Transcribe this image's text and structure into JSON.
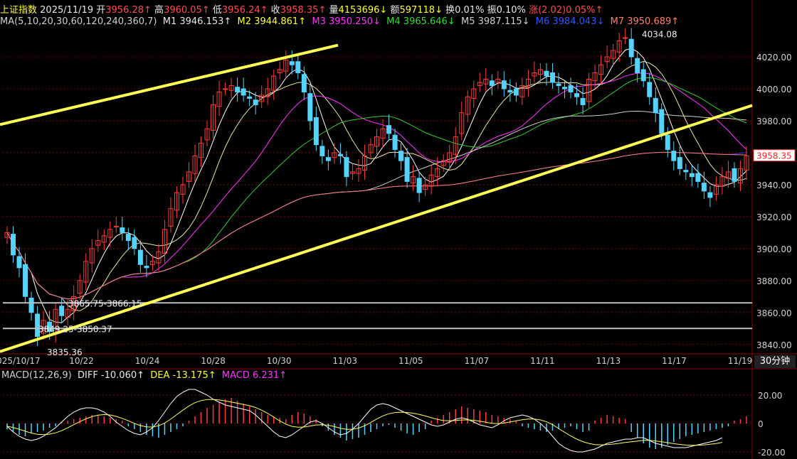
{
  "header": {
    "name": "上证指数",
    "date": "2025/11/19",
    "open_label": "开",
    "open": "3956.28↑",
    "high_label": "高",
    "high": "3960.05↑",
    "low_label": "低",
    "low": "3956.24↑",
    "close_label": "收",
    "close": "3958.35↑",
    "vol_label": "量",
    "vol": "4153696↓",
    "amt_label": "额",
    "amt": "597118↓",
    "turn_label": "换",
    "turn": "0.01%",
    "amp_label": "振",
    "amp": "0.10%",
    "chg_label": "涨",
    "chg": "(2.02)",
    "chg_pct": "0.05%↑"
  },
  "ma": {
    "label": "MA(5,10,20,30,60,120,240,360,7)",
    "m1": "M1 3946.153↑",
    "m2": "M2 3944.861↑",
    "m3": "M3 3950.250↓",
    "m4": "M4 3965.646↓",
    "m5": "M5 3987.115↓",
    "m6": "M6 3984.043↓",
    "m7": "M7 3950.689↑"
  },
  "macd_header": {
    "label": "MACD(12,26,9)",
    "diff": "DIFF -10.060↑",
    "dea": "DEA -13.175↑",
    "macd": "MACD 6.231↑"
  },
  "period": "30分钟",
  "colors": {
    "up": "#ff3b3b",
    "down": "#54d3ff",
    "trendline": "#ffff55",
    "hline": "#c0c0c0",
    "grid": "#7a0000",
    "ma1": "#ffffff",
    "ma2": "#e8e8a0",
    "ma3": "#ff33ff",
    "ma4": "#33cc33",
    "ma5": "#cfcfcf",
    "ma6": "#2a3cff",
    "ma7": "#ff7f6a"
  },
  "chart_data": {
    "type": "candlestick",
    "price_ticks": [
      "4020.00",
      "4000.00",
      "3980.00",
      "3960.00",
      "3940.00",
      "3920.00",
      "3900.00",
      "3880.00",
      "3860.00",
      "3840.00"
    ],
    "price_range": [
      3835,
      4036
    ],
    "x_labels": [
      "2025/10/17",
      "10/22",
      "10/24",
      "10/28",
      "10/30",
      "11/03",
      "11/05",
      "11/07",
      "11/11",
      "11/13",
      "11/17",
      "11/19"
    ],
    "annotations": [
      {
        "text": "4034.08",
        "price": 4034.08
      },
      {
        "text": "3865.75-3866.15",
        "price": 3866
      },
      {
        "text": "3849.25-3850.37",
        "price": 3850
      },
      {
        "text": "3835.36",
        "price": 3835.36
      }
    ],
    "last_price": "3958.35",
    "hlines": [
      3866,
      3850
    ],
    "trendlines": [
      {
        "from_price": 3977.6,
        "to_price": 4027.3,
        "label": "upper"
      },
      {
        "from_price": 3835.5,
        "to_price": 3989.6,
        "label": "lower"
      }
    ],
    "closes": [
      3910,
      3896,
      3888,
      3870,
      3860,
      3845,
      3855,
      3848,
      3862,
      3858,
      3862,
      3870,
      3880,
      3892,
      3900,
      3905,
      3908,
      3912,
      3914,
      3910,
      3905,
      3900,
      3890,
      3888,
      3892,
      3898,
      3912,
      3925,
      3935,
      3940,
      3948,
      3958,
      3966,
      3975,
      3990,
      3998,
      4000,
      4002,
      3998,
      3996,
      3994,
      3990,
      3996,
      4000,
      4008,
      4012,
      4018,
      4015,
      4010,
      3998,
      3980,
      3965,
      3958,
      3955,
      3960,
      3958,
      3945,
      3948,
      3950,
      3958,
      3965,
      3970,
      3975,
      3972,
      3962,
      3955,
      3942,
      3945,
      3935,
      3940,
      3946,
      3950,
      3955,
      3960,
      3970,
      3985,
      3995,
      4000,
      4004,
      4006,
      4002,
      4006,
      4000,
      3998,
      3996,
      4002,
      4006,
      4010,
      4012,
      4008,
      4004,
      4002,
      4000,
      3998,
      3995,
      3990,
      4006,
      4010,
      4015,
      4020,
      4024,
      4030,
      4032,
      4020,
      4010,
      4005,
      3995,
      3985,
      3972,
      3962,
      3955,
      3950,
      3948,
      3945,
      3942,
      3936,
      3932,
      3940,
      3945,
      3948,
      3942,
      3950,
      3958
    ],
    "macd": {
      "range": [
        -22,
        28
      ],
      "ticks": [
        "20.00",
        "0",
        "-20.00"
      ],
      "hist": [
        -4,
        -6,
        -8,
        -9,
        -7,
        -6,
        -5,
        -3,
        -2,
        1,
        2,
        3,
        4,
        5,
        6,
        6,
        5,
        4,
        3,
        2,
        -2,
        -4,
        -6,
        -8,
        -9,
        -10,
        -8,
        -6,
        -4,
        -2,
        2,
        5,
        8,
        11,
        13,
        15,
        17,
        18,
        16,
        14,
        12,
        10,
        8,
        6,
        5,
        4,
        3,
        6,
        8,
        7,
        5,
        3,
        -2,
        -5,
        -8,
        -10,
        -12,
        -11,
        -10,
        -8,
        -6,
        -4,
        -2,
        -1,
        -3,
        -5,
        -7,
        -8,
        -6,
        -4,
        2,
        4,
        6,
        8,
        10,
        12,
        11,
        10,
        9,
        8,
        6,
        5,
        4,
        3,
        2,
        -2,
        -3,
        -4,
        -5,
        -6,
        -5,
        -4,
        -3,
        -2,
        -4,
        -6,
        -5,
        2,
        4,
        6,
        5,
        4,
        3,
        -6,
        -10,
        -14,
        -17,
        -18,
        -17,
        -15,
        -13,
        -11,
        -9,
        -8,
        -7,
        -6,
        -5,
        -4,
        -3,
        -2,
        2,
        3,
        5
      ],
      "diff": [
        -2,
        -6,
        -9,
        -11,
        -12,
        -11,
        -9,
        -6,
        -3,
        1,
        5,
        8,
        10,
        11,
        11,
        10,
        8,
        5,
        1,
        -2,
        -5,
        -7,
        -8,
        -6,
        -3,
        2,
        8,
        14,
        19,
        22,
        24,
        24,
        22,
        20,
        17,
        15,
        13,
        12,
        11,
        10,
        9,
        6,
        2,
        -2,
        -6,
        -9,
        -10,
        -8,
        -5,
        -2,
        1,
        2,
        0,
        -3,
        -6,
        -8,
        -7,
        -4,
        0,
        5,
        10,
        13,
        14,
        13,
        11,
        9,
        7,
        5,
        3,
        1,
        -1,
        -2,
        -1,
        1,
        3,
        4,
        3,
        1,
        -1,
        -2,
        -3,
        -1,
        2,
        4,
        5,
        6,
        5,
        3,
        0,
        -4,
        -9,
        -14,
        -17,
        -19,
        -20,
        -20,
        -19,
        -18,
        -16,
        -14,
        -13,
        -12,
        -11,
        -11,
        -10,
        -10,
        -12,
        -14,
        -15,
        -16,
        -17,
        -17,
        -17,
        -16,
        -15,
        -14,
        -13,
        -12,
        -10
      ]
    }
  }
}
